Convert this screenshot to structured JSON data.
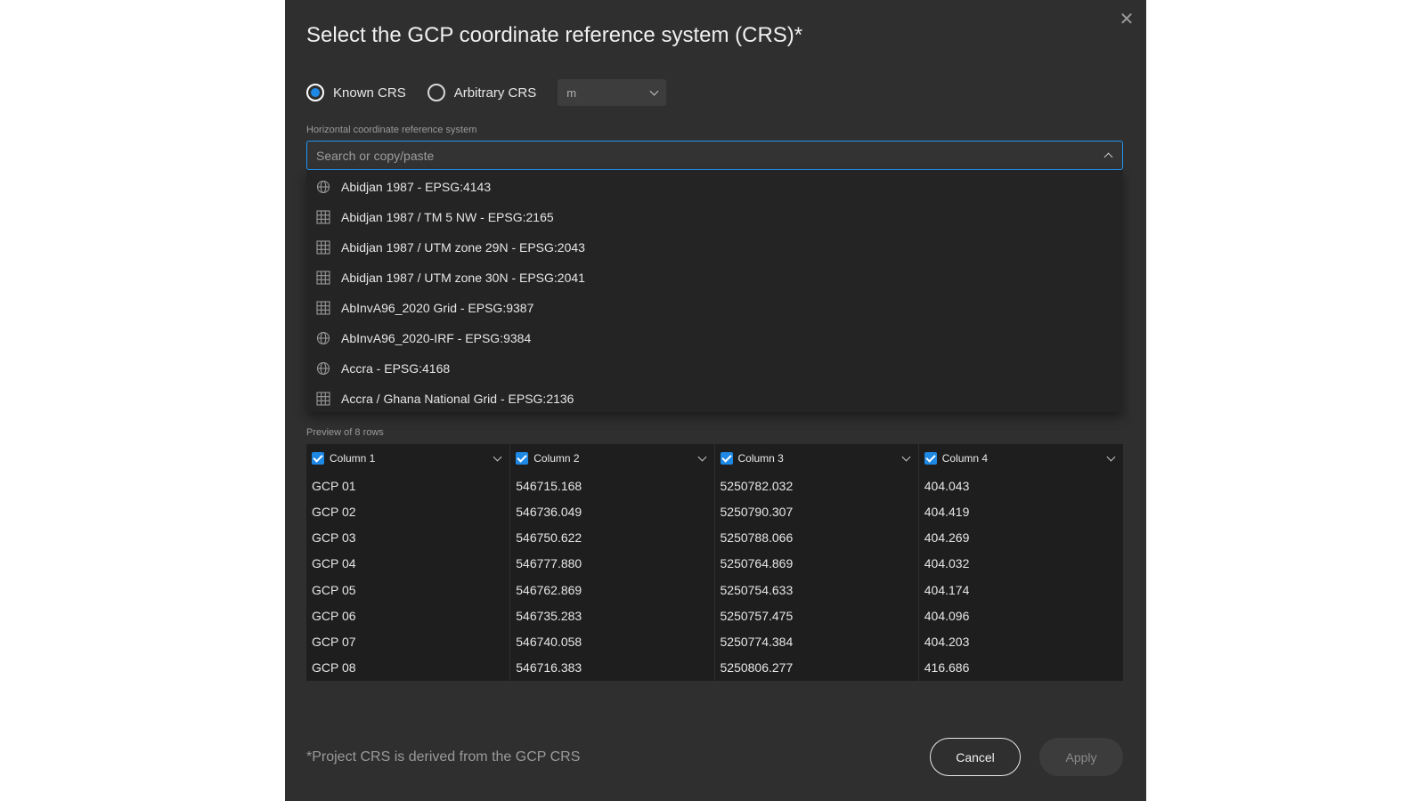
{
  "dialog": {
    "title": "Select the GCP coordinate reference system (CRS)*",
    "close_icon": "close-icon"
  },
  "crs_mode": {
    "options": [
      {
        "label": "Known CRS",
        "selected": true
      },
      {
        "label": "Arbitrary CRS",
        "selected": false
      }
    ],
    "unit": "m"
  },
  "horizontal_crs": {
    "label": "Horizontal coordinate reference system",
    "placeholder": "Search or copy/paste",
    "value": "",
    "expanded": true,
    "items": [
      {
        "label": "Abidjan 1987 - EPSG:4143",
        "icon": "globe-icon"
      },
      {
        "label": "Abidjan 1987 / TM 5 NW - EPSG:2165",
        "icon": "grid-icon"
      },
      {
        "label": "Abidjan 1987 / UTM zone 29N - EPSG:2043",
        "icon": "grid-icon"
      },
      {
        "label": "Abidjan 1987 / UTM zone 30N - EPSG:2041",
        "icon": "grid-icon"
      },
      {
        "label": "AbInvA96_2020 Grid - EPSG:9387",
        "icon": "grid-icon"
      },
      {
        "label": "AbInvA96_2020-IRF - EPSG:9384",
        "icon": "globe-icon"
      },
      {
        "label": "Accra - EPSG:4168",
        "icon": "globe-icon"
      },
      {
        "label": "Accra / Ghana National Grid - EPSG:2136",
        "icon": "grid-icon"
      }
    ]
  },
  "preview": {
    "label": "Preview of 8 rows",
    "columns": [
      {
        "header": "Column 1",
        "checked": true,
        "cells": [
          "GCP 01",
          "GCP 02",
          "GCP 03",
          "GCP 04",
          "GCP 05",
          "GCP 06",
          "GCP 07",
          "GCP 08"
        ]
      },
      {
        "header": "Column 2",
        "checked": true,
        "cells": [
          "546715.168",
          "546736.049",
          "546750.622",
          "546777.880",
          "546762.869",
          "546735.283",
          "546740.058",
          "546716.383"
        ]
      },
      {
        "header": "Column 3",
        "checked": true,
        "cells": [
          "5250782.032",
          "5250790.307",
          "5250788.066",
          "5250764.869",
          "5250754.633",
          "5250757.475",
          "5250774.384",
          "5250806.277"
        ]
      },
      {
        "header": "Column 4",
        "checked": true,
        "cells": [
          "404.043",
          "404.419",
          "404.269",
          "404.032",
          "404.174",
          "404.096",
          "404.203",
          "416.686"
        ]
      }
    ]
  },
  "footer": {
    "note": "*Project CRS is derived from the GCP CRS",
    "cancel_label": "Cancel",
    "apply_label": "Apply"
  },
  "colors": {
    "dialog_bg": "#2f2f2f",
    "accent": "#1e88e5",
    "dropdown_bg": "#242424",
    "table_bg": "#1e1e1e"
  }
}
